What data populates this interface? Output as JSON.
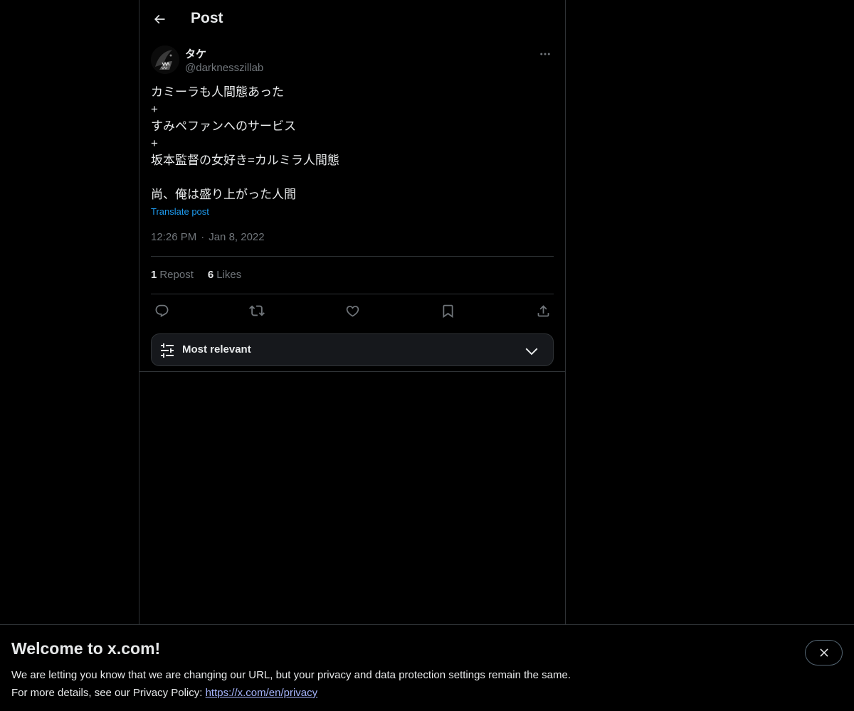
{
  "header": {
    "title": "Post",
    "back_icon": "arrow-left-icon"
  },
  "post": {
    "author": {
      "display_name": "タケ",
      "handle": "@darknesszillab"
    },
    "lines": [
      "カミーラも人間態あった",
      "+",
      "すみペファンへのサービス",
      "+",
      "坂本監督の女好き=カルミラ人間態",
      "",
      "尚、俺は盛り上がった人間"
    ],
    "translate_label": "Translate post",
    "time": "12:26 PM",
    "separator": "·",
    "date": "Jan 8, 2022",
    "stats": {
      "reposts_count": "1",
      "reposts_label": "Repost",
      "likes_count": "6",
      "likes_label": "Likes"
    },
    "actions": [
      "reply-icon",
      "repost-icon",
      "like-icon",
      "bookmark-icon",
      "share-icon"
    ]
  },
  "sort": {
    "label": "Most relevant"
  },
  "banner": {
    "title": "Welcome to x.com!",
    "line1": "We are letting you know that we are changing our URL, but your privacy and data protection settings remain the same.",
    "line2_prefix": "For more details, see our Privacy Policy: ",
    "link": "https://x.com/en/privacy"
  },
  "colors": {
    "background": "#000000",
    "text": "#e7e9ea",
    "muted": "#71767b",
    "accent": "#1d9bf0",
    "border": "#2f3336"
  }
}
